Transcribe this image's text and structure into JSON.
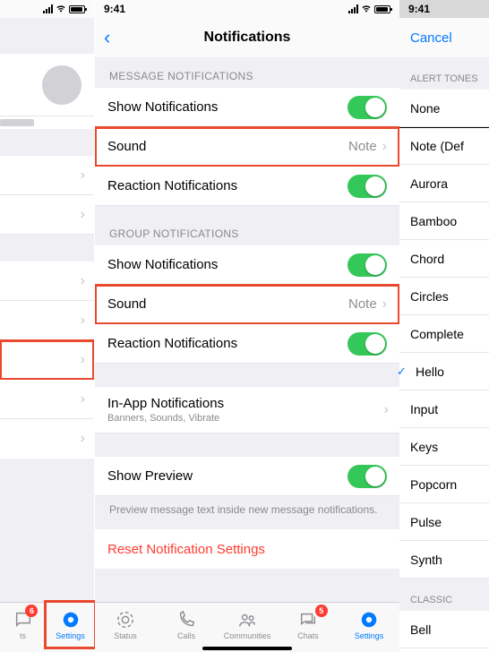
{
  "status": {
    "time": "9:41"
  },
  "col2": {
    "nav_title": "Notifications",
    "section1_header": "MESSAGE NOTIFICATIONS",
    "show_notifications": "Show Notifications",
    "sound_label": "Sound",
    "sound_value": "Note",
    "reaction_label": "Reaction Notifications",
    "section2_header": "GROUP NOTIFICATIONS",
    "inapp_label": "In-App Notifications",
    "inapp_sub": "Banners, Sounds, Vibrate",
    "preview_label": "Show Preview",
    "preview_footer": "Preview message text inside new message notifications.",
    "reset_label": "Reset Notification Settings"
  },
  "col3": {
    "cancel": "Cancel",
    "alert_header": "ALERT TONES",
    "tones": [
      "None",
      "Note (Def",
      "Aurora",
      "Bamboo",
      "Chord",
      "Circles",
      "Complete",
      "Hello",
      "Input",
      "Keys",
      "Popcorn",
      "Pulse",
      "Synth"
    ],
    "classic_header": "CLASSIC",
    "classic_tones": [
      "Bell"
    ],
    "selected": "Hello"
  },
  "tabs": {
    "status": "Status",
    "calls": "Calls",
    "communities": "Communities",
    "chats": "Chats",
    "settings": "Settings",
    "chats_badge": "5",
    "left_badge": "6",
    "left_label_partial": "ts"
  }
}
